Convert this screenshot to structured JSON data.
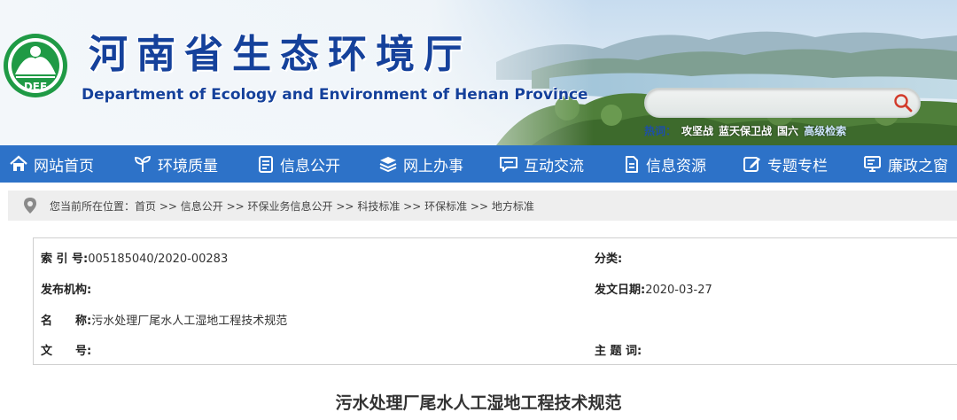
{
  "header": {
    "title": "河南省生态环境厅",
    "subtitle": "Department of Ecology and Environment of Henan Province",
    "logo_text": "DEE",
    "search": {
      "placeholder": "",
      "button_icon": "search-icon"
    },
    "hot": {
      "label": "热词：",
      "items": [
        "攻坚战",
        "蓝天保卫战",
        "国六"
      ],
      "advanced": "高级检索"
    }
  },
  "nav": {
    "items": [
      {
        "label": "网站首页",
        "icon": "home-icon"
      },
      {
        "label": "环境质量",
        "icon": "plant-icon"
      },
      {
        "label": "信息公开",
        "icon": "document-icon"
      },
      {
        "label": "网上办事",
        "icon": "layers-icon"
      },
      {
        "label": "互动交流",
        "icon": "chat-icon"
      },
      {
        "label": "信息资源",
        "icon": "file-icon"
      },
      {
        "label": "专题专栏",
        "icon": "edit-icon"
      },
      {
        "label": "廉政之窗",
        "icon": "monitor-icon"
      }
    ]
  },
  "breadcrumb": {
    "prefix": "您当前所在位置：",
    "items": [
      "首页",
      "信息公开",
      "环保业务信息公开",
      "科技标准",
      "环保标准",
      "地方标准"
    ],
    "separator": " >> "
  },
  "meta": {
    "index_label": "索 引 号:",
    "index_value": "005185040/2020-00283",
    "category_label": "分类:",
    "category_value": "",
    "publisher_label": "发布机构:",
    "publisher_value": "",
    "date_label": "发文日期:",
    "date_value": "2020-03-27",
    "name_label": "名　　称:",
    "name_value": "污水处理厂尾水人工湿地工程技术规范",
    "docno_label": "文　　号:",
    "docno_value": "",
    "subject_label": "主 题 词:",
    "subject_value": ""
  },
  "document": {
    "title": "污水处理厂尾水人工湿地工程技术规范"
  },
  "colors": {
    "brand_blue": "#15419b",
    "nav_blue": "#2d72c8",
    "crumb_bg": "#eeeeee"
  }
}
